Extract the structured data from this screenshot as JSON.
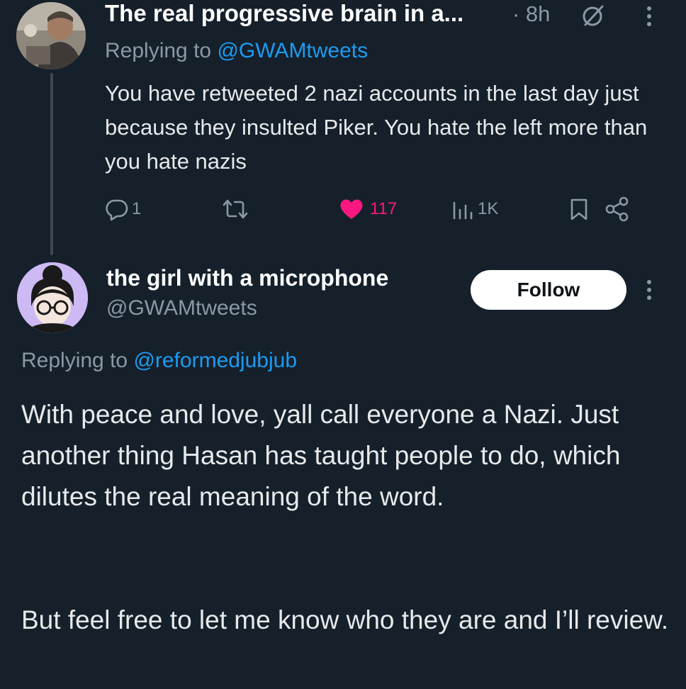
{
  "parent_tweet": {
    "display_name": "The real progressive brain in a...",
    "time": "· 8h",
    "replying_label": "Replying to ",
    "replying_to": "@GWAMtweets",
    "text": "You have retweeted 2 nazi accounts in the last day just because they insulted Piker. You hate the left more than you hate nazis",
    "actions": {
      "replies": "1",
      "likes": "117",
      "views": "1K"
    }
  },
  "main_tweet": {
    "display_name": "the girl with a microphone",
    "handle": "@GWAMtweets",
    "follow_label": "Follow",
    "replying_label": "Replying to ",
    "replying_to": "@reformedjubjub",
    "text_paragraph_1": "With peace and love, yall call everyone a Nazi. Just another thing Hasan has taught people to do, which dilutes the real meaning of the word.",
    "text_paragraph_2": "But feel free to let me know who they are and I’ll review."
  },
  "colors": {
    "background": "#15202b",
    "text": "#e7e9ea",
    "muted": "#8b98a5",
    "link": "#1d9bf0",
    "like": "#f91880"
  },
  "icons": [
    "grok-icon",
    "more-icon",
    "reply-icon",
    "retweet-icon",
    "heart-icon",
    "views-icon",
    "bookmark-icon",
    "share-icon"
  ]
}
